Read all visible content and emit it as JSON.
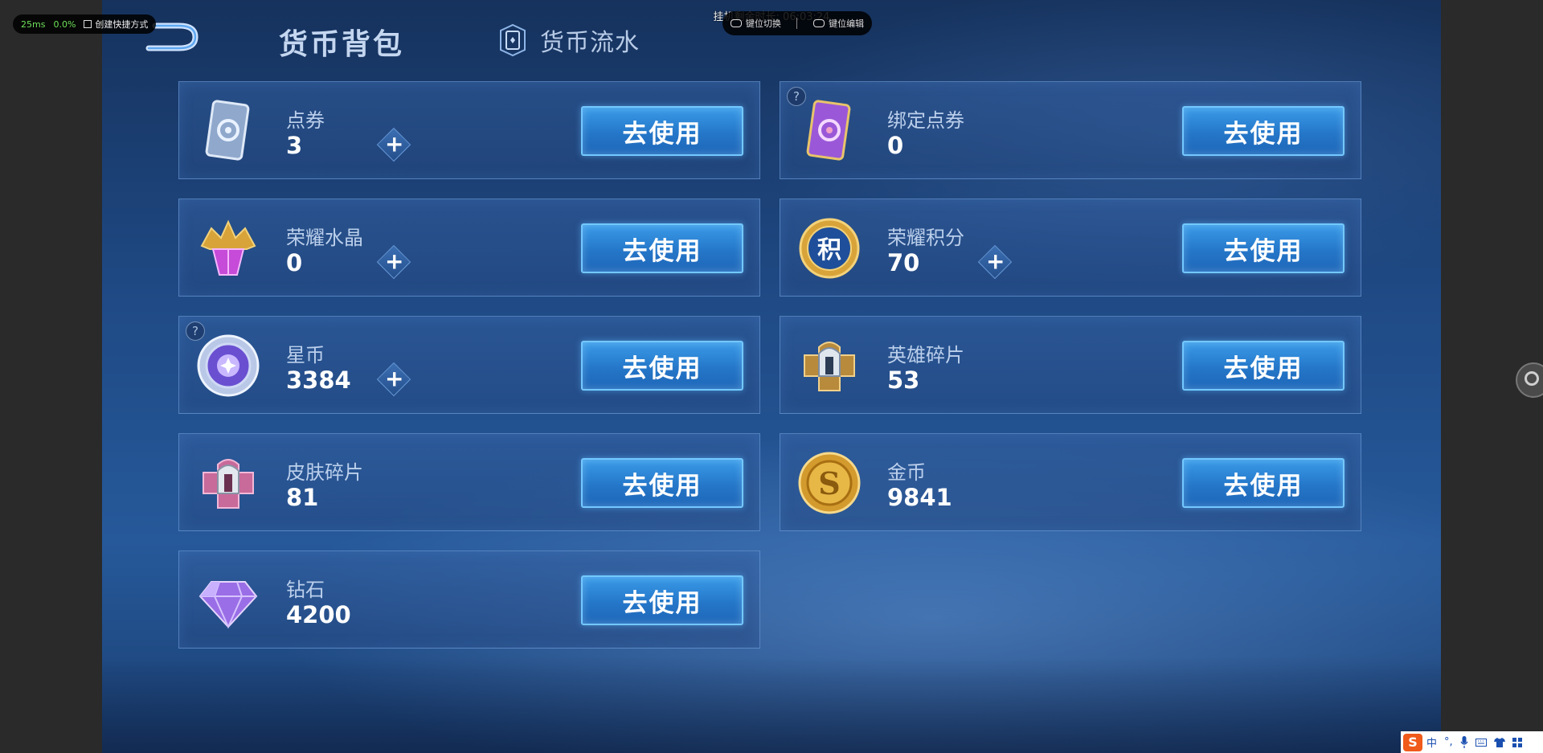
{
  "header": {
    "title": "货币背包",
    "flow_tab": "货币流水"
  },
  "overlay": {
    "latency": "25ms",
    "loss": "0.0%",
    "shortcut": "创建快捷方式",
    "timer": "挂机剩余时长: 06:03:24",
    "key_switch": "键位切换",
    "key_edit": "键位编辑"
  },
  "currencies": [
    {
      "name": "点券",
      "value": "3",
      "action": "去使用",
      "icon": "coupon-card-icon",
      "plus": true,
      "help": false
    },
    {
      "name": "绑定点券",
      "value": "0",
      "action": "去使用",
      "icon": "bound-coupon-card-icon",
      "plus": false,
      "help": true
    },
    {
      "name": "荣耀水晶",
      "value": "0",
      "action": "去使用",
      "icon": "glory-crystal-icon",
      "plus": true,
      "help": false
    },
    {
      "name": "荣耀积分",
      "value": "70",
      "action": "去使用",
      "icon": "glory-points-icon",
      "plus": true,
      "help": false
    },
    {
      "name": "星币",
      "value": "3384",
      "action": "去使用",
      "icon": "star-coin-icon",
      "plus": true,
      "help": true
    },
    {
      "name": "英雄碎片",
      "value": "53",
      "action": "去使用",
      "icon": "hero-fragment-icon",
      "plus": false,
      "help": false
    },
    {
      "name": "皮肤碎片",
      "value": "81",
      "action": "去使用",
      "icon": "skin-fragment-icon",
      "plus": false,
      "help": false
    },
    {
      "name": "金币",
      "value": "9841",
      "action": "去使用",
      "icon": "gold-coin-icon",
      "plus": false,
      "help": false
    },
    {
      "name": "钻石",
      "value": "4200",
      "action": "去使用",
      "icon": "diamond-icon",
      "plus": false,
      "help": false
    }
  ],
  "glyphs": {
    "plus": "+",
    "help": "?",
    "glory_points_char": "积",
    "gold_coin_char": "S"
  },
  "ime": {
    "logo": "S",
    "mode": "中",
    "punct": "°,",
    "mic": "mic-icon",
    "keyboard": "keyboard-icon",
    "skin": "shirt-icon",
    "menu": "grid-icon"
  },
  "colors": {
    "button": "#2a82d6",
    "button_border": "#73c8ff",
    "card_border": "#78aae6",
    "gold": "#d8a43a",
    "purple": "#9a58d8"
  }
}
